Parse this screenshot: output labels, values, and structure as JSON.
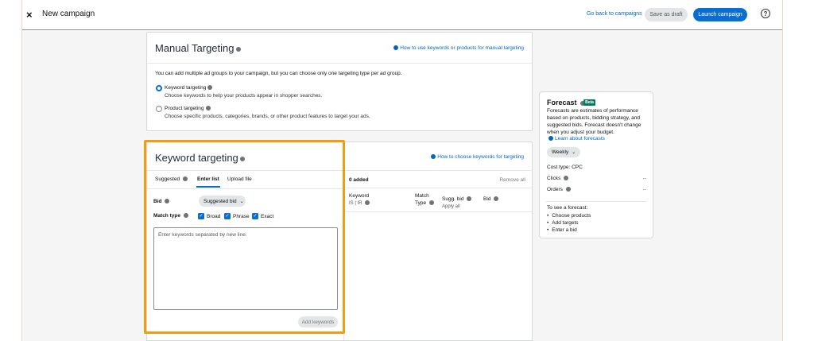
{
  "header": {
    "close_icon": "×",
    "title": "New campaign",
    "back_link": "Go back to campaigns",
    "save_draft": "Save as draft",
    "launch": "Launch campaign",
    "help_icon": "?"
  },
  "manual_targeting": {
    "title": "Manual Targeting",
    "howto_link": "How to use keywords or products for manual targeting",
    "description": "You can add multiple ad groups to your campaign, but you can choose only one targeting type per ad group.",
    "options": [
      {
        "title": "Keyword targeting",
        "desc": "Choose keywords to help your products appear in shopper searches.",
        "selected": true
      },
      {
        "title": "Product targeting",
        "desc": "Choose specific products, categories, brands, or other product features to target your ads.",
        "selected": false
      }
    ]
  },
  "keyword_targeting": {
    "title": "Keyword targeting",
    "howto_link": "How to choose keywords for targeting",
    "tabs": [
      "Suggested",
      "Enter list",
      "Upload file"
    ],
    "active_tab": "Enter list",
    "bid_label": "Bid",
    "bid_value": "Suggested bid",
    "match_type_label": "Match type",
    "match_types": [
      "Broad",
      "Phrase",
      "Exact"
    ],
    "textarea_placeholder": "Enter keywords separated by new line.",
    "add_button": "Add keywords",
    "added_count": "0 added",
    "remove_all": "Remove all",
    "columns": {
      "keyword": "Keyword",
      "keyword_sub": "IS | IR",
      "match": "Match",
      "match_sub": "Type",
      "sugg_bid": "Sugg. bid",
      "apply_all": "Apply all",
      "bid": "Bid"
    }
  },
  "forecast": {
    "title": "Forecast",
    "badge": "Beta",
    "description": "Forecasts are estimates of performance based on products, bidding strategy, and suggested bids. Forecast doesn't change when you adjust your budget.",
    "learn_link": "Learn about forecasts",
    "period": "Weekly",
    "cost_type": "Cost type: CPC",
    "clicks_label": "Clicks",
    "clicks_value": "--",
    "orders_label": "Orders",
    "orders_value": "--",
    "see_forecast": "To see a forecast:",
    "steps": [
      "Choose products",
      "Add targets",
      "Enter a bid"
    ]
  },
  "colors": {
    "accent": "#0a6ed1",
    "highlight": "#f39c12",
    "beta_badge": "#067d62"
  }
}
